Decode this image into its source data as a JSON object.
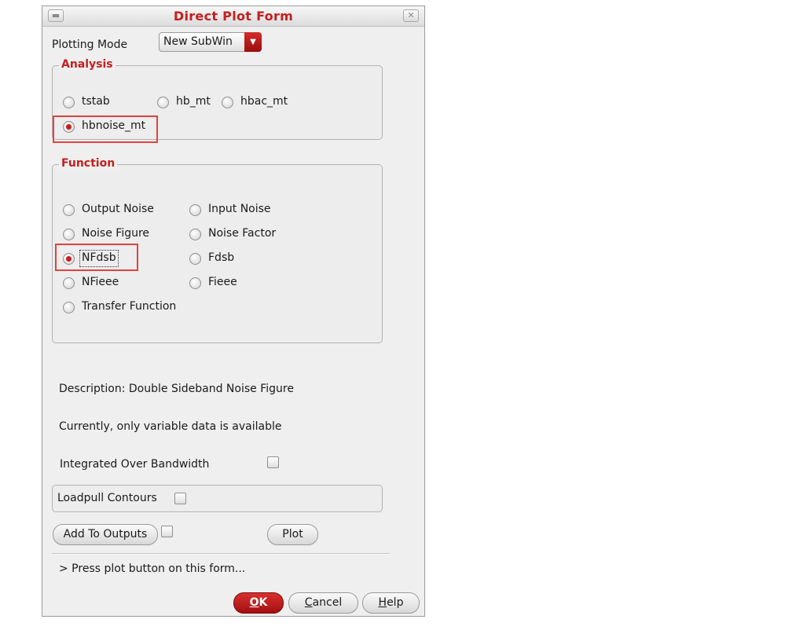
{
  "window": {
    "title": "Direct Plot Form"
  },
  "plotting_mode": {
    "label": "Plotting Mode",
    "selected": "New SubWin"
  },
  "analysis": {
    "title": "Analysis",
    "options": [
      "tstab",
      "hb_mt",
      "hbac_mt",
      "hbnoise_mt"
    ],
    "selected": "hbnoise_mt"
  },
  "function": {
    "title": "Function",
    "options": [
      "Output Noise",
      "Input Noise",
      "Noise Figure",
      "Noise Factor",
      "NFdsb",
      "Fdsb",
      "NFieee",
      "Fieee",
      "Transfer Function"
    ],
    "selected": "NFdsb"
  },
  "description": "Description: Double Sideband Noise Figure",
  "data_note": "Currently, only variable data is available",
  "integrated_label": "Integrated Over Bandwidth",
  "loadpull_label": "Loadpull Contours",
  "buttons": {
    "add_to_outputs": "Add To Outputs",
    "plot": "Plot",
    "ok_mn": "O",
    "ok_rest": "K",
    "cancel_mn": "C",
    "cancel_rest": "ancel",
    "help_mn": "H",
    "help_rest": "elp"
  },
  "status": "> Press plot button on this form...",
  "colors": {
    "accent": "#c41e1e",
    "highlight": "#e0433f"
  }
}
